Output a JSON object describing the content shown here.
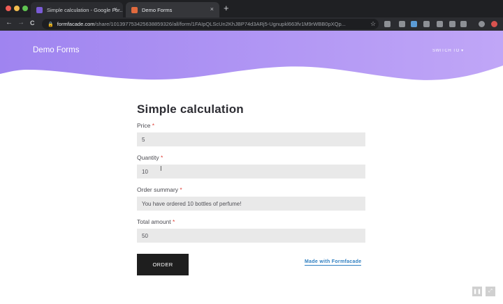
{
  "browser": {
    "tabs": [
      {
        "title": "Simple calculation - Google For...",
        "close": "×"
      },
      {
        "title": "Demo Forms",
        "close": "×"
      }
    ],
    "new_tab": "+",
    "nav": {
      "back": "←",
      "forward": "→",
      "reload": "C"
    },
    "address": {
      "lock": "🔒",
      "host": "formfacade.com",
      "path": "/share/101397753425638859326/all/form/1FAIpQLScUn2KhJBP74d3ARj5-Ugnupkl663fv1M9rWBB0pXQp..."
    },
    "star": "☆"
  },
  "header": {
    "brand": "Demo Forms",
    "switch_to": "SWITCH TO ▾",
    "gradient_start": "#9f84f0",
    "gradient_end": "#c0a6f7"
  },
  "form": {
    "title": "Simple calculation",
    "required_mark": "*",
    "fields": [
      {
        "label": "Price",
        "value": "5"
      },
      {
        "label": "Quantity",
        "value": "10"
      },
      {
        "label": "Order summary",
        "value": "You have ordered 10 bottles of perfume!"
      },
      {
        "label": "Total amount",
        "value": "50"
      }
    ],
    "order_button": "ORDER",
    "made_with": "Made with Formfacade"
  },
  "player": {
    "pause": "❚❚",
    "expand": "⤢"
  }
}
